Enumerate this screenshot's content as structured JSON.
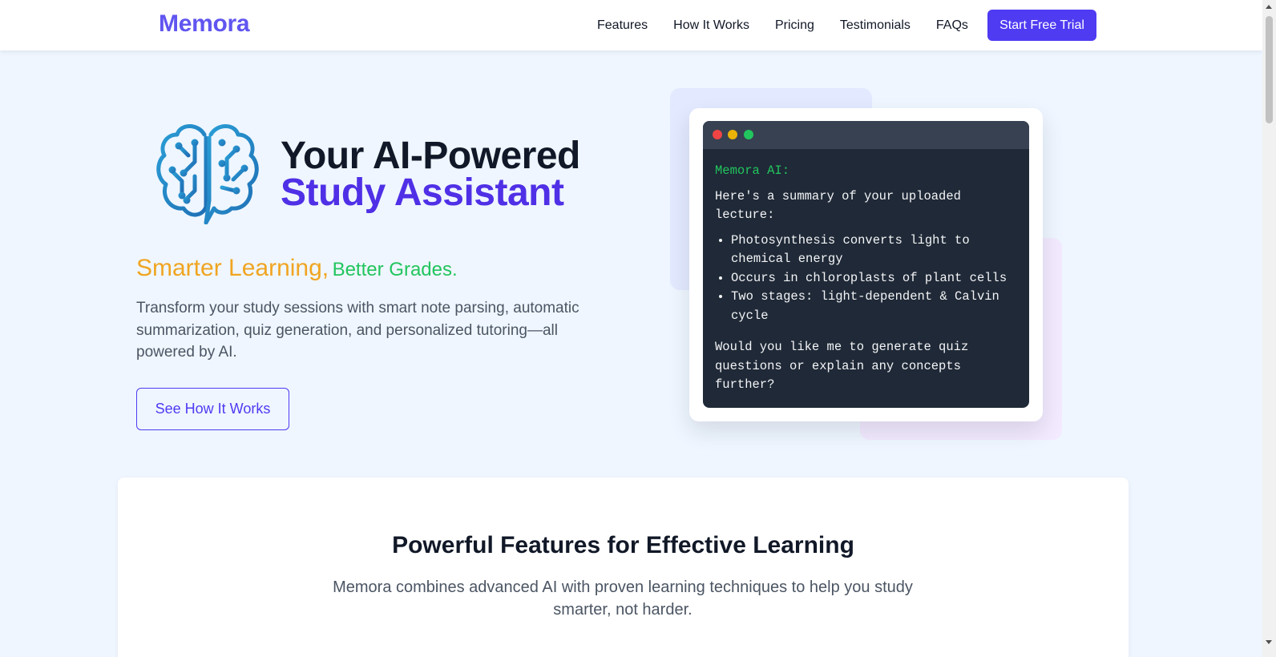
{
  "header": {
    "logo": "Memora",
    "nav": [
      "Features",
      "How It Works",
      "Pricing",
      "Testimonials",
      "FAQs"
    ],
    "cta": "Start Free Trial"
  },
  "hero": {
    "title_line1": "Your AI-Powered",
    "title_line2": "Study Assistant",
    "tagline_a": "Smarter Learning,",
    "tagline_b": "Better Grades.",
    "description": "Transform your study sessions with smart note parsing, automatic summarization, quiz generation, and personalized tutoring—all powered by AI.",
    "secondary_button": "See How It Works",
    "logo_icon": "brain-circuit-icon"
  },
  "chat": {
    "speaker": "Memora AI:",
    "intro": "Here's a summary of your uploaded lecture:",
    "points": [
      "Photosynthesis converts light to chemical energy",
      "Occurs in chloroplasts of plant cells",
      "Two stages: light-dependent & Calvin cycle"
    ],
    "followup": "Would you like me to generate quiz questions or explain any concepts further?"
  },
  "features": {
    "heading": "Powerful Features for Effective Learning",
    "subheading": "Memora combines advanced AI with proven learning techniques to help you study smarter, not harder."
  },
  "colors": {
    "brand": "#4f3bf2",
    "logo": "#6055f0",
    "accent_orange": "#f0a521",
    "accent_green": "#22c55e",
    "page_bg": "#eff6ff"
  }
}
